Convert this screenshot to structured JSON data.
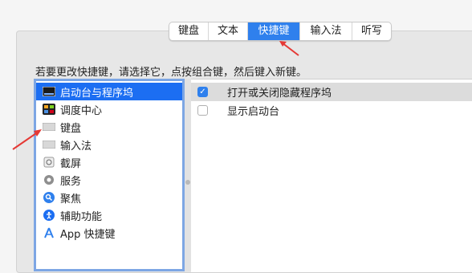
{
  "tabs": [
    {
      "label": "键盘",
      "selected": false
    },
    {
      "label": "文本",
      "selected": false
    },
    {
      "label": "快捷键",
      "selected": true
    },
    {
      "label": "输入法",
      "selected": false
    },
    {
      "label": "听写",
      "selected": false
    }
  ],
  "instruction": "若要更改快捷键，请选择它，点按组合键，然后键入新键。",
  "categories": [
    {
      "label": "启动台与程序坞",
      "icon": "launchpad-dock-icon",
      "selected": true
    },
    {
      "label": "调度中心",
      "icon": "mission-control-icon",
      "selected": false
    },
    {
      "label": "键盘",
      "icon": "keyboard-icon",
      "selected": false
    },
    {
      "label": "输入法",
      "icon": "input-source-icon",
      "selected": false
    },
    {
      "label": "截屏",
      "icon": "screenshot-icon",
      "selected": false
    },
    {
      "label": "服务",
      "icon": "gear-icon",
      "selected": false
    },
    {
      "label": "聚焦",
      "icon": "spotlight-icon",
      "selected": false
    },
    {
      "label": "辅助功能",
      "icon": "accessibility-icon",
      "selected": false
    },
    {
      "label": "App 快捷键",
      "icon": "app-shortcuts-icon",
      "selected": false
    }
  ],
  "shortcuts": [
    {
      "label": "打开或关闭隐藏程序坞",
      "checked": true
    },
    {
      "label": "显示启动台",
      "checked": false
    }
  ],
  "colors": {
    "accent": "#2f80ed",
    "selection": "#1c6ef2",
    "annotation_arrow": "#e53935"
  }
}
